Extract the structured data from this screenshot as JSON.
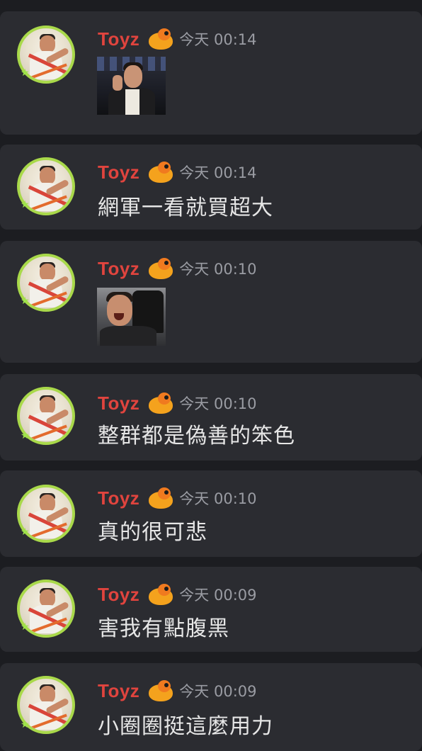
{
  "messages": [
    {
      "username": "Toyz",
      "timestamp": "今天 00:14",
      "type": "image",
      "image_icon": "photo-man-on-phone"
    },
    {
      "username": "Toyz",
      "timestamp": "今天 00:14",
      "type": "text",
      "text": "網軍一看就買超大"
    },
    {
      "username": "Toyz",
      "timestamp": "今天 00:10",
      "type": "image",
      "image_icon": "photo-man-laughing"
    },
    {
      "username": "Toyz",
      "timestamp": "今天 00:10",
      "type": "text",
      "text": "整群都是偽善的笨色"
    },
    {
      "username": "Toyz",
      "timestamp": "今天 00:10",
      "type": "text",
      "text": "真的很可悲"
    },
    {
      "username": "Toyz",
      "timestamp": "今天 00:09",
      "type": "text",
      "text": "害我有點腹黑"
    },
    {
      "username": "Toyz",
      "timestamp": "今天 00:09",
      "type": "text",
      "text": "小圈圈挺這麼用力"
    }
  ],
  "colors": {
    "background": "#1c1d21",
    "card": "#2b2c31",
    "username": "#e0443e",
    "timestamp": "#9a9ca3",
    "text": "#e6e6e6",
    "avatar_ring": "#a9d94a"
  },
  "icons": {
    "avatar": "user-avatar-wrestler",
    "badge": "duck-badge-icon",
    "status": "star-status-icon"
  }
}
